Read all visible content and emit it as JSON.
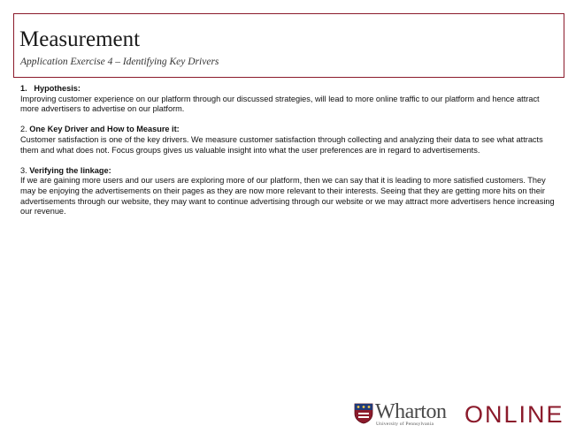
{
  "header": {
    "title": "Measurement",
    "subtitle": "Application Exercise 4 – Identifying Key Drivers"
  },
  "sections": [
    {
      "number": "1.",
      "heading": "Hypothesis:",
      "body": "Improving customer experience on our platform through our discussed strategies, will lead to more online traffic to our platform and hence attract more advertisers to advertise on our platform."
    },
    {
      "number": "2.",
      "heading": "One Key Driver and How to Measure it:",
      "body": "Customer satisfaction is one of the key drivers. We measure customer satisfaction through collecting and analyzing their data to see what attracts them and what does not. Focus groups gives us valuable insight into what the user preferences are in regard to advertisements."
    },
    {
      "number": "3.",
      "heading": "Verifying the linkage:",
      "body": "If we are gaining more users and our users are exploring more of our platform, then we can say that it is leading to more satisfied customers. They may be enjoying the advertisements on their pages as they are now more relevant to their interests. Seeing that they are getting more hits on their advertisements through our website, they may want to continue advertising through our website or we may attract more advertisers hence increasing our revenue."
    }
  ],
  "footer": {
    "logo_word": "Wharton",
    "logo_subtext": "University of Pennsylvania",
    "online_label": "ONLINE",
    "brand_color": "#8b1a2b",
    "logo_icon": "penn-shield-icon"
  }
}
